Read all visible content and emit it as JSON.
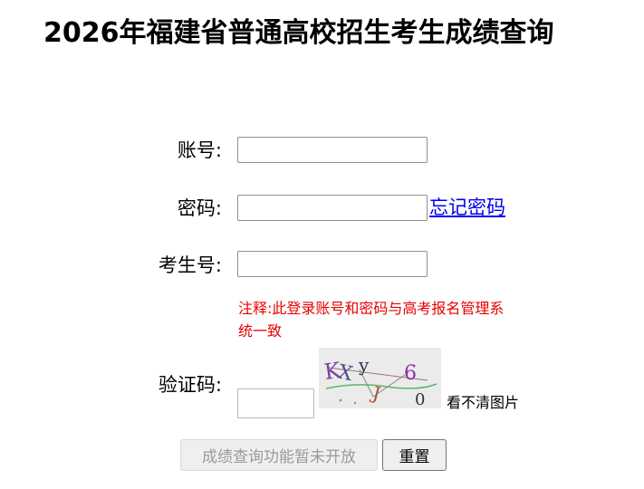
{
  "page": {
    "title": "2026年福建省普通高校招生考生成绩查询"
  },
  "form": {
    "account_label": "账号:",
    "account_value": "",
    "password_label": "密码:",
    "password_value": "",
    "forgot_password_link": "忘记密码",
    "exam_number_label": "考生号:",
    "exam_number_value": "",
    "note": "注释:此登录账号和密码与高考报名管理系统一致",
    "captcha_label": "验证码:",
    "captcha_value": "",
    "captcha_image_text": "KXy6J0",
    "captcha_refresh_link": "看不清图片",
    "query_button": "成绩查询功能暂未开放",
    "reset_button": "重置"
  },
  "colors": {
    "note_text": "#e60000",
    "link": "#0000ee",
    "disabled_text": "#9a9a9a"
  }
}
